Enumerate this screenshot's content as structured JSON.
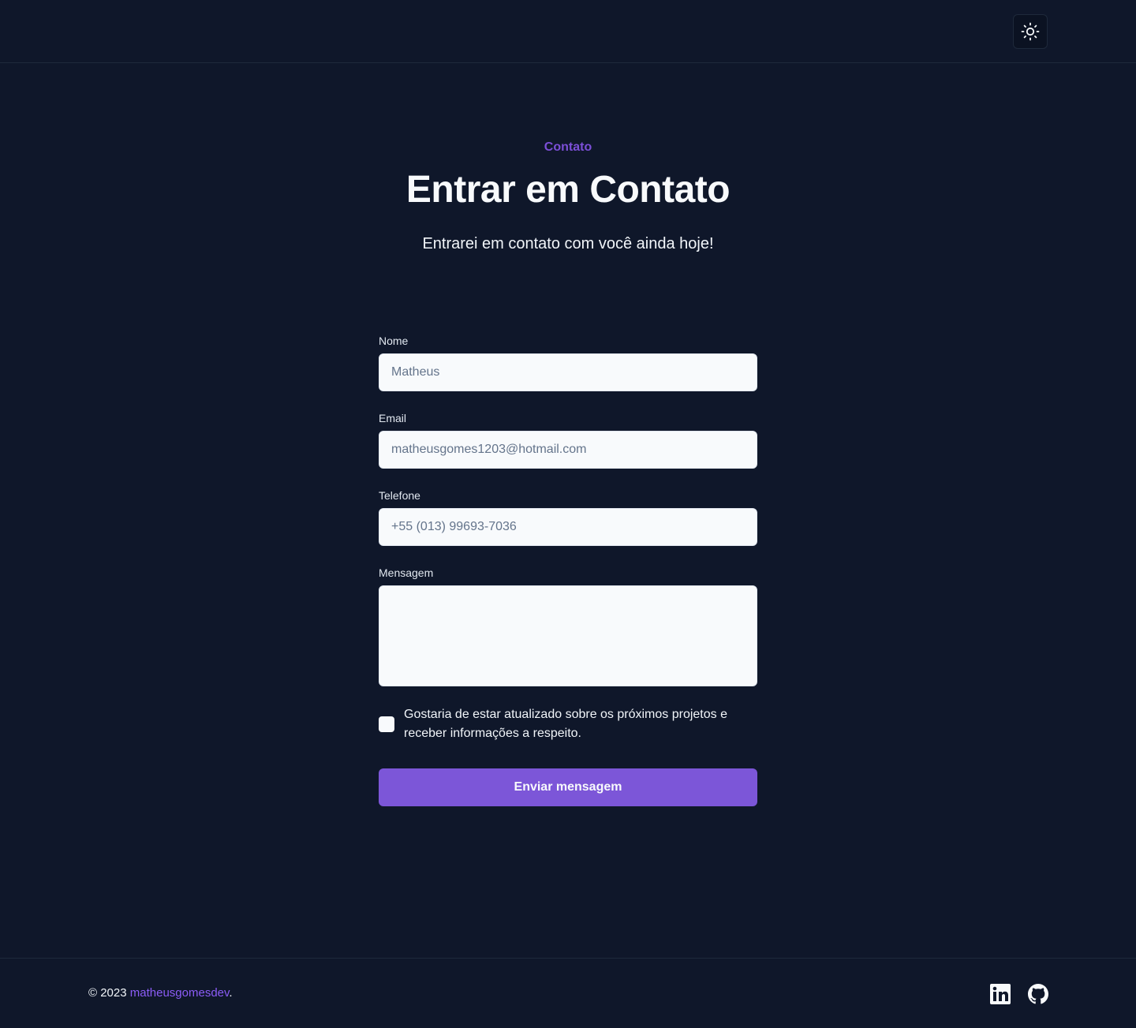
{
  "header": {
    "theme_toggle_icon": "sun-icon"
  },
  "hero": {
    "eyebrow": "Contato",
    "title": "Entrar em Contato",
    "subtitle": "Entrarei em contato com você ainda hoje!"
  },
  "form": {
    "name": {
      "label": "Nome",
      "value": "",
      "placeholder": "Matheus"
    },
    "email": {
      "label": "Email",
      "value": "",
      "placeholder": "matheusgomes1203@hotmail.com"
    },
    "phone": {
      "label": "Telefone",
      "value": "",
      "placeholder": "+55 (013) 99693-7036"
    },
    "message": {
      "label": "Mensagem",
      "value": "",
      "placeholder": ""
    },
    "newsletter": {
      "label": "Gostaria de estar atualizado sobre os próximos projetos e receber informações a respeito.",
      "checked": false
    },
    "submit_label": "Enviar mensagem"
  },
  "footer": {
    "copyright_prefix": "© 2023 ",
    "author_link": "matheusgomesdev",
    "copyright_suffix": ".",
    "social": [
      {
        "icon": "linkedin-icon"
      },
      {
        "icon": "github-icon"
      }
    ]
  },
  "colors": {
    "background": "#0f172a",
    "accent": "#7c56d8",
    "input_background": "#f8fafc",
    "border": "#1e293b"
  }
}
